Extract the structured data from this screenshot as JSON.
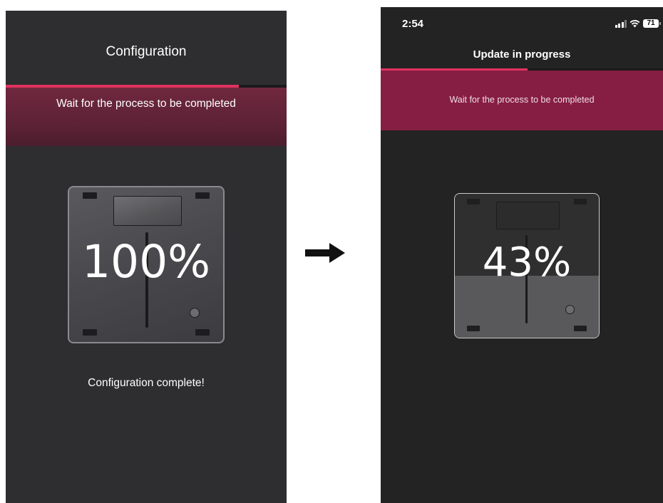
{
  "left_screen": {
    "title": "Configuration",
    "progress_fraction": 0.83,
    "banner_text": "Wait for the process to be completed",
    "percent_label": "100%",
    "status_message": "Configuration complete!"
  },
  "right_screen": {
    "status_bar": {
      "time": "2:54",
      "battery": "71",
      "icons": [
        "signal-icon",
        "wifi-icon",
        "battery-icon"
      ]
    },
    "title": "Update in progress",
    "progress_fraction": 0.52,
    "banner_text": "Wait for the process to be completed",
    "percent_label": "43%",
    "fill_fraction": 0.43
  },
  "arrow_icon": "right-arrow-icon",
  "colors": {
    "accent": "#e0325f",
    "banner_left": "#6a263b",
    "banner_right": "#861e43",
    "background_left": "#2e2e30",
    "background_right": "#232323"
  }
}
